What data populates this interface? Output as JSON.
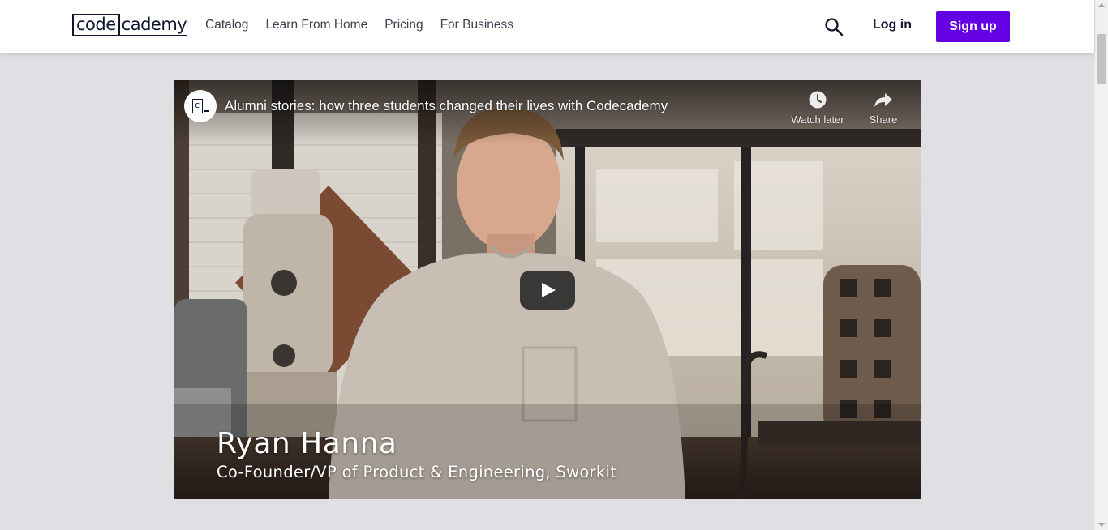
{
  "header": {
    "logo": {
      "box_text": "code",
      "rest_text": "cademy"
    },
    "nav": [
      "Catalog",
      "Learn From Home",
      "Pricing",
      "For Business"
    ],
    "login_label": "Log in",
    "signup_label": "Sign up",
    "search_icon": "search-icon"
  },
  "video": {
    "title": "Alumni stories: how three students changed their lives with Codecademy",
    "channel_avatar_text": "c",
    "watch_later_label": "Watch later",
    "share_label": "Share",
    "person_name": "Ryan Hanna",
    "person_role": "Co-Founder/VP of Product & Engineering, Sworkit"
  },
  "colors": {
    "page_background": "#e0dfe4",
    "brand_dark": "#10162f",
    "signup_accent": "#6400e4"
  }
}
